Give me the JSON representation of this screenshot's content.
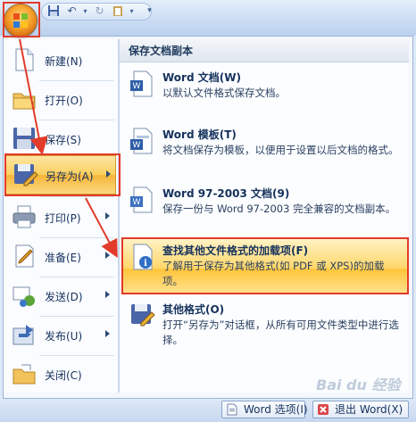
{
  "menu": {
    "left_items": [
      {
        "label": "新建(N)"
      },
      {
        "label": "打开(O)"
      },
      {
        "label": "保存(S)"
      },
      {
        "label": "另存为(A)"
      },
      {
        "label": "打印(P)"
      },
      {
        "label": "准备(E)"
      },
      {
        "label": "发送(D)"
      },
      {
        "label": "发布(U)"
      },
      {
        "label": "关闭(C)"
      }
    ],
    "right_header": "保存文档副本",
    "right_items": [
      {
        "title": "Word 文档(W)",
        "desc": "以默认文件格式保存文档。"
      },
      {
        "title": "Word 模板(T)",
        "desc": "将文档保存为模板，以便用于设置以后文档的格式。"
      },
      {
        "title": "Word 97-2003 文档(9)",
        "desc": "保存一份与 Word 97-2003 完全兼容的文档副本。"
      },
      {
        "title": "查找其他文件格式的加载项(F)",
        "desc": "了解用于保存为其他格式(如 PDF 或 XPS)的加载项。"
      },
      {
        "title": "其他格式(O)",
        "desc": "打开“另存为”对话框，从所有可用文件类型中进行选择。"
      }
    ]
  },
  "bottom": {
    "options_label": "Word 选项(I)",
    "exit_label": "退出 Word(X)"
  },
  "watermark": "Bai du 经验",
  "colors": {
    "highlight": "#fcd97f",
    "annotation": "#e23a2a",
    "accent": "#1e395b"
  }
}
